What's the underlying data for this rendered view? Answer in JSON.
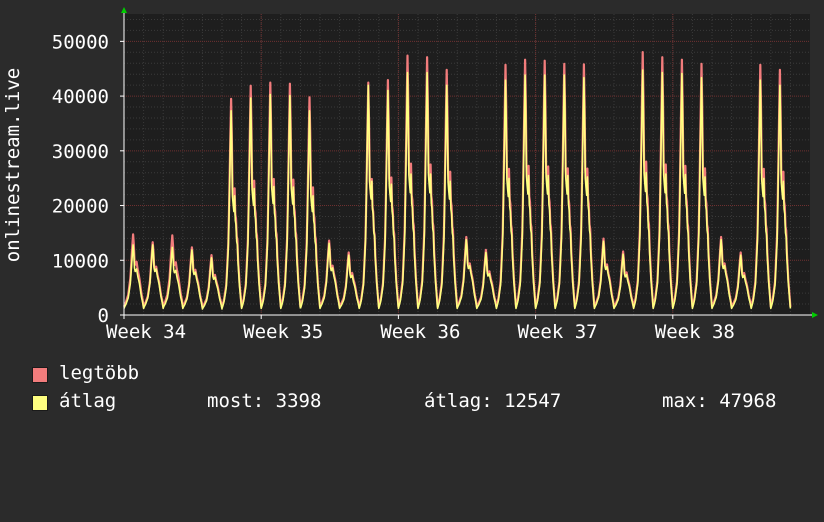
{
  "chart_data": {
    "type": "line",
    "ylabel": "onlinestream.live",
    "ylim": [
      0,
      55000
    ],
    "yticks": [
      0,
      10000,
      20000,
      30000,
      40000,
      50000
    ],
    "ytick_labels": [
      "0",
      "10000",
      "20000",
      "30000",
      "40000",
      "50000"
    ],
    "xlim": [
      0,
      35
    ],
    "xtick_labels": [
      "Week 34",
      "Week 35",
      "Week 36",
      "Week 37",
      "Week 38"
    ],
    "xtick_days": [
      0,
      7,
      14,
      21,
      28
    ],
    "grid": true,
    "legend_position": "bottom-left",
    "gap_days": [
      9
    ],
    "series": [
      {
        "name": "legtöbb",
        "color": "#f27c7c",
        "days": [
          0,
          1,
          2,
          3,
          4,
          5,
          6,
          7,
          8,
          9,
          10,
          11,
          12,
          13,
          14,
          15,
          16,
          17,
          18,
          19,
          20,
          21,
          22,
          23,
          24,
          25,
          26,
          27,
          28,
          29,
          30,
          31,
          32,
          33
        ],
        "peaks": [
          15500,
          14000,
          15300,
          13000,
          11500,
          42300,
          44900,
          45500,
          45300,
          42600,
          14300,
          12000,
          45500,
          46000,
          50800,
          50500,
          48000,
          15000,
          12500,
          49000,
          50000,
          49800,
          49200,
          49100,
          14700,
          12200,
          51500,
          50500,
          50000,
          49200,
          15000,
          12000,
          49000,
          48000
        ],
        "troughs": [
          1500,
          1500,
          1600,
          1500,
          1400,
          1500,
          1500,
          1500,
          1500,
          1500,
          1500,
          1500,
          1500,
          1500,
          1500,
          1500,
          1500,
          1500,
          1500,
          1500,
          1500,
          1500,
          1500,
          1500,
          1500,
          1500,
          1500,
          1500,
          1500,
          1500,
          1500,
          1500,
          1500,
          1500
        ]
      },
      {
        "name": "átlag",
        "color": "#ffff80",
        "days": [
          0,
          1,
          2,
          3,
          4,
          5,
          6,
          7,
          8,
          9,
          10,
          11,
          12,
          13,
          14,
          15,
          16,
          17,
          18,
          19,
          20,
          21,
          22,
          23,
          24,
          25,
          26,
          27,
          28,
          29,
          30,
          31,
          32,
          33
        ],
        "peaks": [
          13500,
          13500,
          13000,
          12500,
          11000,
          40000,
          42500,
          43200,
          43000,
          40000,
          13800,
          11500,
          45000,
          44000,
          47500,
          47500,
          45000,
          14500,
          12000,
          46000,
          47000,
          47000,
          47000,
          46500,
          14200,
          11700,
          48000,
          47500,
          47300,
          46500,
          14500,
          11500,
          46000,
          45000
        ],
        "troughs": [
          1200,
          1200,
          1300,
          1200,
          1100,
          1200,
          1200,
          1200,
          1200,
          1200,
          1200,
          1200,
          1200,
          1200,
          1200,
          1200,
          1200,
          1200,
          1200,
          1200,
          1200,
          1200,
          1200,
          1200,
          1200,
          1200,
          1200,
          1200,
          1200,
          1200,
          1200,
          1200,
          1200,
          1200
        ]
      }
    ]
  },
  "legend": {
    "max_label": "legtöbb",
    "avg_label": "átlag",
    "max_color": "#f27c7c",
    "avg_color": "#ffff80"
  },
  "stats": {
    "most": "most: 3398",
    "atlag": "átlag: 12547",
    "max": "max: 47968"
  }
}
